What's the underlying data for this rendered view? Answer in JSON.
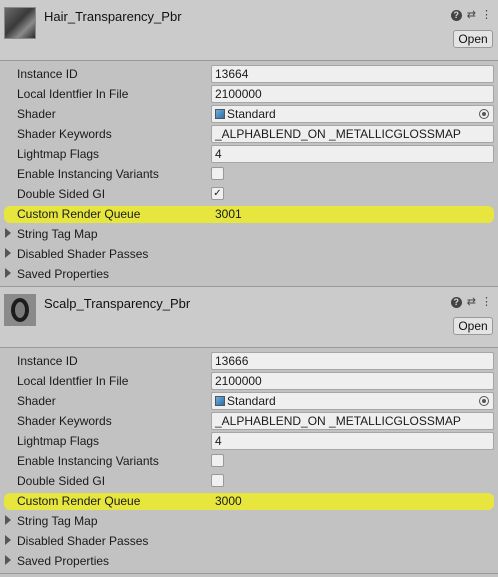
{
  "materials": [
    {
      "name": "Hair_Transparency_Pbr",
      "open_label": "Open",
      "instance_id_label": "Instance ID",
      "instance_id": "13664",
      "local_id_label": "Local Identfier In File",
      "local_id": "2100000",
      "shader_label": "Shader",
      "shader": "Standard",
      "keywords_label": "Shader Keywords",
      "keywords": "_ALPHABLEND_ON _METALLICGLOSSMAP",
      "lightmap_label": "Lightmap Flags",
      "lightmap": "4",
      "instancing_label": "Enable Instancing Variants",
      "instancing_checked": false,
      "double_sided_label": "Double Sided GI",
      "double_sided_checked": true,
      "render_queue_label": "Custom Render Queue",
      "render_queue": "3001",
      "foldouts": [
        "String Tag Map",
        "Disabled Shader Passes",
        "Saved Properties"
      ]
    },
    {
      "name": "Scalp_Transparency_Pbr",
      "open_label": "Open",
      "instance_id_label": "Instance ID",
      "instance_id": "13666",
      "local_id_label": "Local Identfier In File",
      "local_id": "2100000",
      "shader_label": "Shader",
      "shader": "Standard",
      "keywords_label": "Shader Keywords",
      "keywords": "_ALPHABLEND_ON _METALLICGLOSSMAP",
      "lightmap_label": "Lightmap Flags",
      "lightmap": "4",
      "instancing_label": "Enable Instancing Variants",
      "instancing_checked": false,
      "double_sided_label": "Double Sided GI",
      "double_sided_checked": false,
      "render_queue_label": "Custom Render Queue",
      "render_queue": "3000",
      "foldouts": [
        "String Tag Map",
        "Disabled Shader Passes",
        "Saved Properties"
      ]
    }
  ],
  "icons": {
    "help": "help-icon",
    "presets": "presets-icon",
    "menu": "menu-icon",
    "check": "✓"
  },
  "colors": {
    "highlight": "#eeee22",
    "background": "#c2c2c2"
  }
}
